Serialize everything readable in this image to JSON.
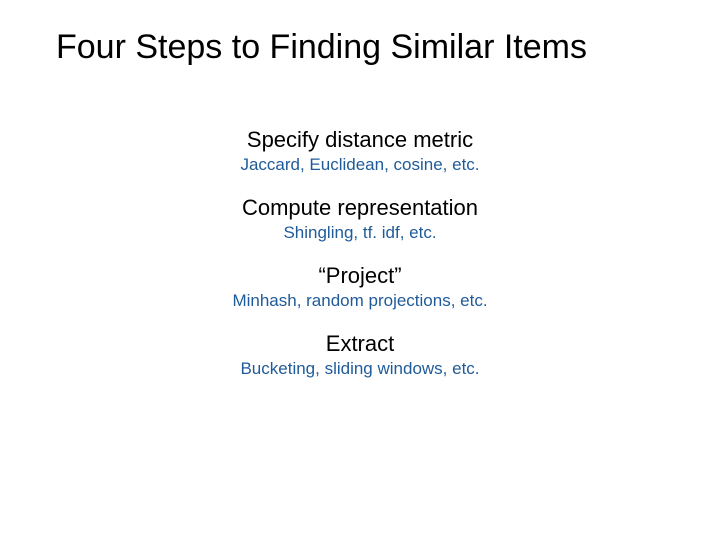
{
  "title": "Four Steps to Finding Similar Items",
  "steps": [
    {
      "title": "Specify distance metric",
      "detail": "Jaccard, Euclidean, cosine, etc."
    },
    {
      "title": "Compute representation",
      "detail": "Shingling, tf. idf, etc."
    },
    {
      "title": "“Project”",
      "detail": "Minhash, random projections, etc."
    },
    {
      "title": "Extract",
      "detail": "Bucketing, sliding windows, etc."
    }
  ]
}
